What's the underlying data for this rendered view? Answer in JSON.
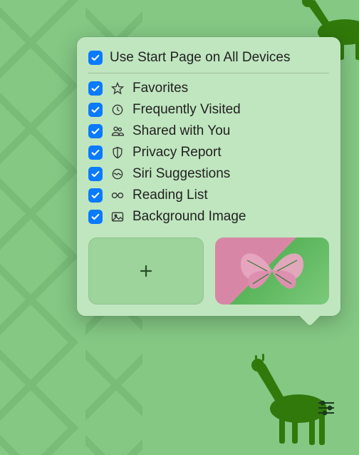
{
  "popover": {
    "top": {
      "label": "Use Start Page on All Devices",
      "checked": true
    },
    "items": [
      {
        "icon": "star",
        "label": "Favorites",
        "checked": true
      },
      {
        "icon": "clock",
        "label": "Frequently Visited",
        "checked": true
      },
      {
        "icon": "shared",
        "label": "Shared with You",
        "checked": true
      },
      {
        "icon": "shield",
        "label": "Privacy Report",
        "checked": true
      },
      {
        "icon": "siri",
        "label": "Siri Suggestions",
        "checked": true
      },
      {
        "icon": "glasses",
        "label": "Reading List",
        "checked": true
      },
      {
        "icon": "image",
        "label": "Background Image",
        "checked": true
      }
    ]
  },
  "thumbs": {
    "add": "add",
    "preview": "wallpaper-preview"
  },
  "settingsButton": "customize-settings"
}
